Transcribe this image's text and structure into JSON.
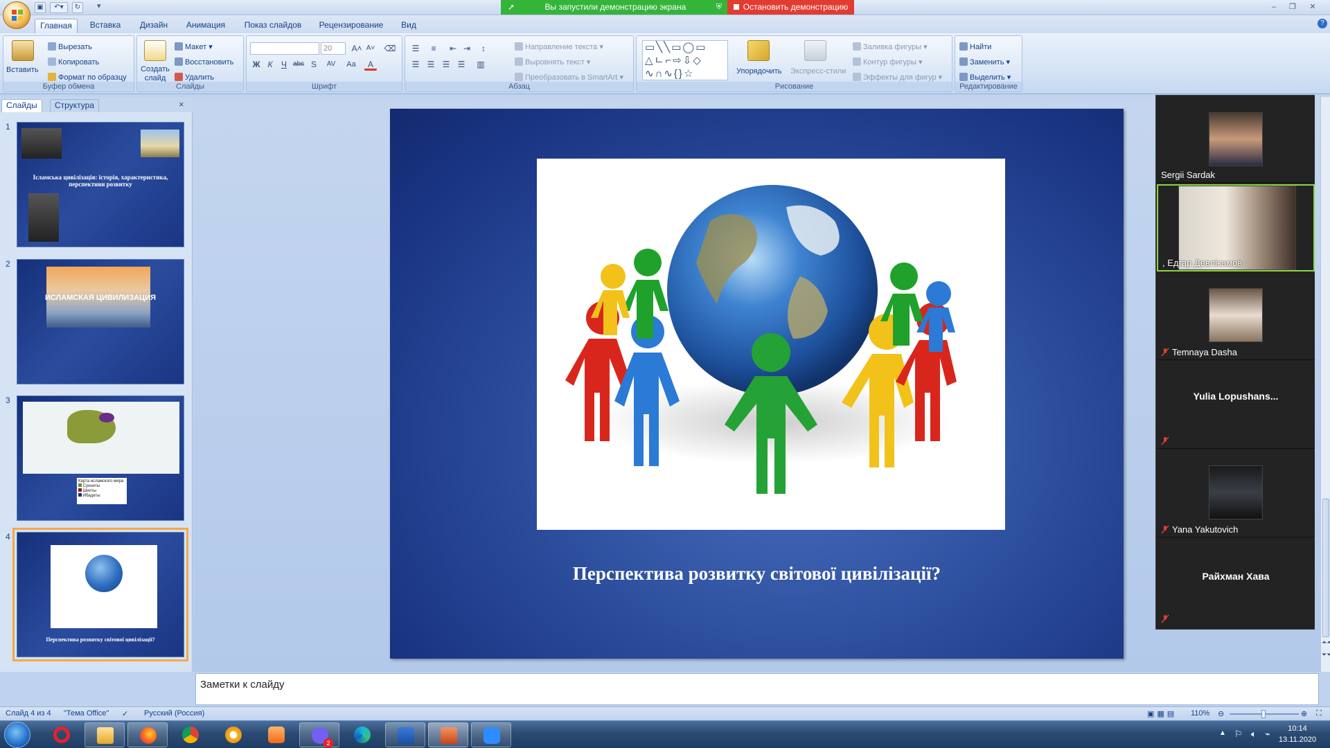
{
  "app": {
    "share_notice": "Вы запустили демонстрацию экрана",
    "stop_share": "Остановить демонстрацию"
  },
  "tabs": [
    "Главная",
    "Вставка",
    "Дизайн",
    "Анимация",
    "Показ слайдов",
    "Рецензирование",
    "Вид"
  ],
  "ribbon": {
    "clipboard": {
      "label": "Буфер обмена",
      "paste": "Вставить",
      "cut": "Вырезать",
      "copy": "Копировать",
      "format_painter": "Формат по образцу"
    },
    "slides": {
      "label": "Слайды",
      "new_slide": "Создать слайд",
      "layout": "Макет",
      "reset": "Восстановить",
      "delete": "Удалить"
    },
    "font": {
      "label": "Шрифт",
      "size": "20",
      "bold": "Ж",
      "italic": "К",
      "underline": "Ч",
      "strike": "abc",
      "shadow": "S",
      "spacing": "AV",
      "case": "Aa",
      "color": "A"
    },
    "paragraph": {
      "label": "Абзац",
      "text_direction": "Направление текста",
      "align_text": "Выровнять текст",
      "smartart": "Преобразовать в SmartArt"
    },
    "drawing": {
      "label": "Рисование",
      "arrange": "Упорядочить",
      "quick_styles": "Экспресс-стили",
      "fill": "Заливка фигуры",
      "outline": "Контур фигуры",
      "effects": "Эффекты для фигур"
    },
    "editing": {
      "label": "Редактирование",
      "find": "Найти",
      "replace": "Заменить",
      "select": "Выделить"
    }
  },
  "left_panel": {
    "tab_slides": "Слайды",
    "tab_outline": "Структура",
    "thumbnails": [
      {
        "num": "1",
        "title": "Ісламська цивілізація: історія, характеристика, перспективи розвитку"
      },
      {
        "num": "2",
        "title": "ИСЛАМСКАЯ ЦИВИЛИЗАЦИЯ"
      },
      {
        "num": "3",
        "title": "Карта исламского мира",
        "legend": [
          "Сунниты",
          "Шииты",
          "Ибадиты"
        ]
      },
      {
        "num": "4",
        "title": "Перспектива розвитку світової цивілізації?"
      }
    ]
  },
  "slide": {
    "title": "Перспектива розвитку світової цивілізації?"
  },
  "notes": {
    "placeholder": "Заметки к слайду"
  },
  "participants": [
    {
      "name": "Sergii Sardak",
      "video": true,
      "muted": false
    },
    {
      "name": ", Едгар Девлікамов",
      "video": true,
      "muted": false,
      "speaking": true
    },
    {
      "name": "Temnaya Dasha",
      "video": true,
      "muted": true
    },
    {
      "name": "Yulia  Lopushans...",
      "video": false,
      "muted": true
    },
    {
      "name": "Yana Yakutovich",
      "video": true,
      "muted": true
    },
    {
      "name": "Райхман Хава",
      "video": false,
      "muted": true
    }
  ],
  "status": {
    "slide_counter": "Слайд 4 из 4",
    "theme": "\"Тема Office\"",
    "language": "Русский (Россия)",
    "zoom": "110%"
  },
  "taskbar": {
    "time": "10:14",
    "date": "13.11.2020",
    "viber_badge": "2"
  },
  "colors": {
    "accent": "#15428b",
    "slide_bg": "#2d4f9e",
    "share_green": "#35b43a",
    "share_red": "#e23c32",
    "selected_thumb": "#f5a945"
  }
}
